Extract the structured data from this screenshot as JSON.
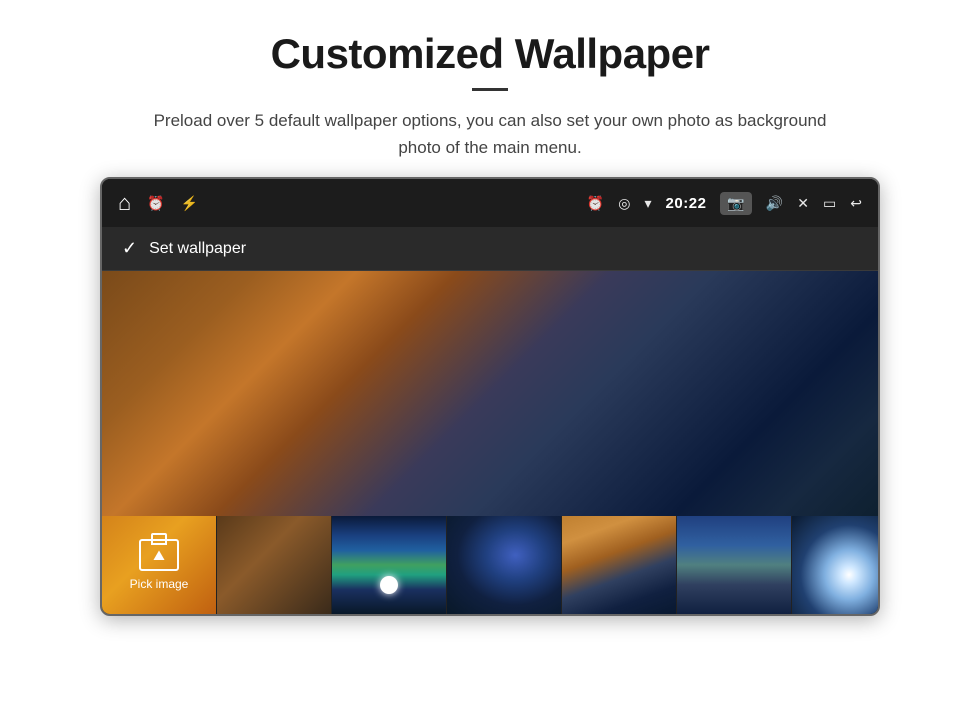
{
  "page": {
    "title": "Customized Wallpaper",
    "subtitle": "Preload over 5 default wallpaper options, you can also set your own photo as background photo of the main menu."
  },
  "device": {
    "statusBar": {
      "time": "20:22",
      "icons": {
        "home": "⌂",
        "alarm": "⏰",
        "usb": "⚡",
        "location": "📍",
        "wifi": "▼",
        "camera": "📷",
        "volume": "🔊",
        "close": "✕",
        "window": "▭",
        "back": "↩"
      }
    },
    "toolbar": {
      "check": "✓",
      "label": "Set wallpaper"
    },
    "thumbnails": {
      "first": {
        "icon": "🖼",
        "label": "Pick image"
      }
    }
  }
}
